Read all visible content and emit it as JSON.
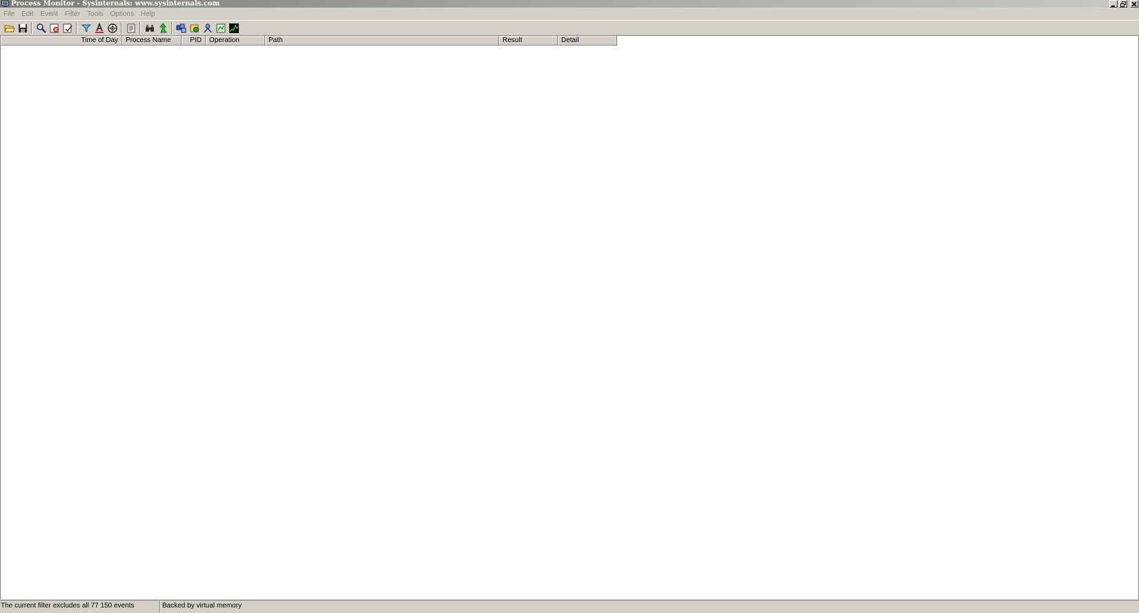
{
  "window": {
    "title": "Process Monitor - Sysinternals: www.sysinternals.com"
  },
  "menu": {
    "items": [
      "File",
      "Edit",
      "Event",
      "Filter",
      "Tools",
      "Options",
      "Help"
    ]
  },
  "toolbar": {
    "buttons": [
      {
        "icon": "open-folder-icon"
      },
      {
        "icon": "save-icon"
      },
      {
        "icon": "magnifier-icon"
      },
      {
        "icon": "autoscroll-icon"
      },
      {
        "icon": "clear-icon"
      },
      {
        "icon": "filter-icon"
      },
      {
        "icon": "highlight-icon"
      },
      {
        "icon": "network-icon"
      },
      {
        "icon": "process-tree-icon"
      },
      {
        "icon": "find-icon"
      },
      {
        "icon": "jump-to-icon"
      },
      {
        "icon": "registry-activity-icon"
      },
      {
        "icon": "file-activity-icon"
      },
      {
        "icon": "network-activity-icon"
      },
      {
        "icon": "process-activity-icon"
      },
      {
        "icon": "profiling-icon"
      }
    ]
  },
  "columns": [
    {
      "label": "Time of Day"
    },
    {
      "label": "Process Name"
    },
    {
      "label": "PID"
    },
    {
      "label": "Operation"
    },
    {
      "label": "Path"
    },
    {
      "label": "Result"
    },
    {
      "label": "Detail"
    }
  ],
  "status": {
    "filter_text": "The current filter excludes all 77 150 events",
    "memory_text": "Backed by virtual memory"
  },
  "colors": {
    "face": "#d4d0c8",
    "highlight": "#ffffff",
    "shadow": "#808080",
    "disabled_text": "#808080"
  }
}
